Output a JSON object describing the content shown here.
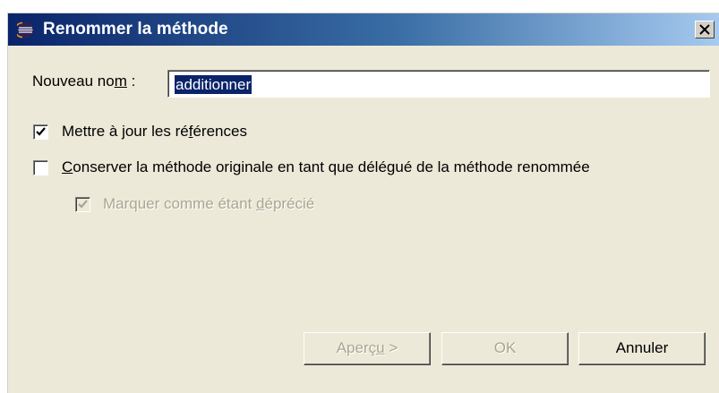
{
  "window": {
    "title": "Renommer la méthode",
    "icon": "eclipse-icon",
    "close_label": "close-icon"
  },
  "form": {
    "name_label_pre": "Nouveau no",
    "name_label_mnemonic": "m",
    "name_label_post": " :",
    "name_value": "additionner"
  },
  "options": {
    "update_refs": {
      "label_pre": "Mettre à jour les ré",
      "label_mnemonic": "f",
      "label_post": "érences",
      "checked": true,
      "enabled": true
    },
    "keep_original": {
      "label_mnemonic": "C",
      "label_post": "onserver la méthode originale en tant que délégué de la méthode renommée",
      "checked": false,
      "enabled": true
    },
    "mark_deprecated": {
      "label_pre": "Marquer comme étant ",
      "label_mnemonic": "d",
      "label_post": "éprécié",
      "checked": true,
      "enabled": false
    }
  },
  "buttons": {
    "preview_pre": "Aperç",
    "preview_mnemonic": "u",
    "preview_post": " >",
    "ok": "OK",
    "cancel": "Annuler"
  },
  "colors": {
    "titlebar_start": "#0a246a",
    "titlebar_end": "#a6caf0",
    "dialog_bg": "#ece9d8",
    "selection": "#0a246a",
    "disabled_text": "#a9a692"
  }
}
